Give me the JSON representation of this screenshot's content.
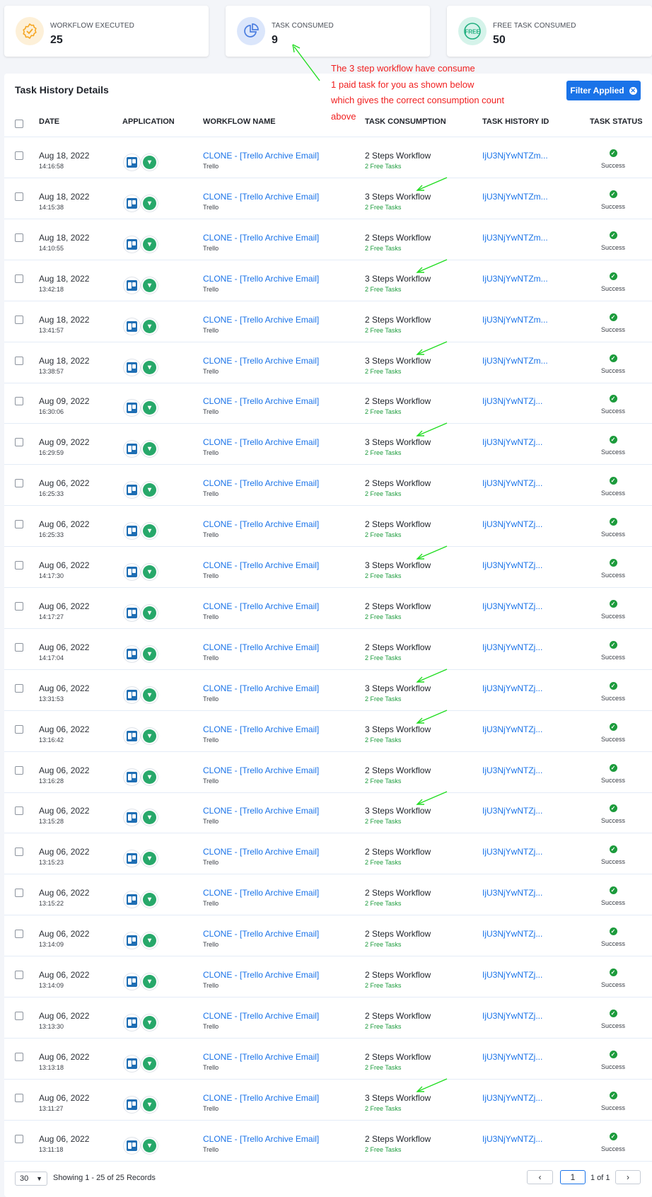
{
  "stats": [
    {
      "label": "WORKFLOW EXECUTED",
      "value": "25",
      "icon": "badge-check-icon",
      "color": "#f5a623"
    },
    {
      "label": "TASK CONSUMED",
      "value": "9",
      "icon": "pie-chart-icon",
      "color": "#4a7de0"
    },
    {
      "label": "FREE TASK CONSUMED",
      "value": "50",
      "icon": "free-icon",
      "color": "#1fae7e"
    }
  ],
  "annotation": {
    "line1": "The 3 step workflow have consume",
    "line2": "1 paid task for you as shown below",
    "line3": "which gives the correct consumption count",
    "line4": "above"
  },
  "panel": {
    "title": "Task History Details",
    "filter_label": "Filter Applied"
  },
  "columns": {
    "date": "DATE",
    "application": "APPLICATION",
    "workflow": "WORKFLOW NAME",
    "consumption": "TASK CONSUMPTION",
    "history_id": "TASK HISTORY ID",
    "status": "TASK STATUS"
  },
  "rows": [
    {
      "date": "Aug 18, 2022",
      "time": "14:16:58",
      "workflow": "CLONE - [Trello Archive Email]",
      "app": "Trello",
      "consumption": "2 Steps Workflow",
      "free": "2 Free Tasks",
      "history_id": "IjU3NjYwNTZm...",
      "status": "Success"
    },
    {
      "date": "Aug 18, 2022",
      "time": "14:15:38",
      "workflow": "CLONE - [Trello Archive Email]",
      "app": "Trello",
      "consumption": "3 Steps Workflow",
      "free": "2 Free Tasks",
      "history_id": "IjU3NjYwNTZm...",
      "status": "Success"
    },
    {
      "date": "Aug 18, 2022",
      "time": "14:10:55",
      "workflow": "CLONE - [Trello Archive Email]",
      "app": "Trello",
      "consumption": "2 Steps Workflow",
      "free": "2 Free Tasks",
      "history_id": "IjU3NjYwNTZm...",
      "status": "Success"
    },
    {
      "date": "Aug 18, 2022",
      "time": "13:42:18",
      "workflow": "CLONE - [Trello Archive Email]",
      "app": "Trello",
      "consumption": "3 Steps Workflow",
      "free": "2 Free Tasks",
      "history_id": "IjU3NjYwNTZm...",
      "status": "Success"
    },
    {
      "date": "Aug 18, 2022",
      "time": "13:41:57",
      "workflow": "CLONE - [Trello Archive Email]",
      "app": "Trello",
      "consumption": "2 Steps Workflow",
      "free": "2 Free Tasks",
      "history_id": "IjU3NjYwNTZm...",
      "status": "Success"
    },
    {
      "date": "Aug 18, 2022",
      "time": "13:38:57",
      "workflow": "CLONE - [Trello Archive Email]",
      "app": "Trello",
      "consumption": "3 Steps Workflow",
      "free": "2 Free Tasks",
      "history_id": "IjU3NjYwNTZm...",
      "status": "Success"
    },
    {
      "date": "Aug 09, 2022",
      "time": "16:30:06",
      "workflow": "CLONE - [Trello Archive Email]",
      "app": "Trello",
      "consumption": "2 Steps Workflow",
      "free": "2 Free Tasks",
      "history_id": "IjU3NjYwNTZj...",
      "status": "Success"
    },
    {
      "date": "Aug 09, 2022",
      "time": "16:29:59",
      "workflow": "CLONE - [Trello Archive Email]",
      "app": "Trello",
      "consumption": "3 Steps Workflow",
      "free": "2 Free Tasks",
      "history_id": "IjU3NjYwNTZj...",
      "status": "Success"
    },
    {
      "date": "Aug 06, 2022",
      "time": "16:25:33",
      "workflow": "CLONE - [Trello Archive Email]",
      "app": "Trello",
      "consumption": "2 Steps Workflow",
      "free": "2 Free Tasks",
      "history_id": "IjU3NjYwNTZj...",
      "status": "Success"
    },
    {
      "date": "Aug 06, 2022",
      "time": "16:25:33",
      "workflow": "CLONE - [Trello Archive Email]",
      "app": "Trello",
      "consumption": "2 Steps Workflow",
      "free": "2 Free Tasks",
      "history_id": "IjU3NjYwNTZj...",
      "status": "Success"
    },
    {
      "date": "Aug 06, 2022",
      "time": "14:17:30",
      "workflow": "CLONE - [Trello Archive Email]",
      "app": "Trello",
      "consumption": "3 Steps Workflow",
      "free": "2 Free Tasks",
      "history_id": "IjU3NjYwNTZj...",
      "status": "Success"
    },
    {
      "date": "Aug 06, 2022",
      "time": "14:17:27",
      "workflow": "CLONE - [Trello Archive Email]",
      "app": "Trello",
      "consumption": "2 Steps Workflow",
      "free": "2 Free Tasks",
      "history_id": "IjU3NjYwNTZj...",
      "status": "Success"
    },
    {
      "date": "Aug 06, 2022",
      "time": "14:17:04",
      "workflow": "CLONE - [Trello Archive Email]",
      "app": "Trello",
      "consumption": "2 Steps Workflow",
      "free": "2 Free Tasks",
      "history_id": "IjU3NjYwNTZj...",
      "status": "Success"
    },
    {
      "date": "Aug 06, 2022",
      "time": "13:31:53",
      "workflow": "CLONE - [Trello Archive Email]",
      "app": "Trello",
      "consumption": "3 Steps Workflow",
      "free": "2 Free Tasks",
      "history_id": "IjU3NjYwNTZj...",
      "status": "Success"
    },
    {
      "date": "Aug 06, 2022",
      "time": "13:16:42",
      "workflow": "CLONE - [Trello Archive Email]",
      "app": "Trello",
      "consumption": "3 Steps Workflow",
      "free": "2 Free Tasks",
      "history_id": "IjU3NjYwNTZj...",
      "status": "Success"
    },
    {
      "date": "Aug 06, 2022",
      "time": "13:16:28",
      "workflow": "CLONE - [Trello Archive Email]",
      "app": "Trello",
      "consumption": "2 Steps Workflow",
      "free": "2 Free Tasks",
      "history_id": "IjU3NjYwNTZj...",
      "status": "Success"
    },
    {
      "date": "Aug 06, 2022",
      "time": "13:15:28",
      "workflow": "CLONE - [Trello Archive Email]",
      "app": "Trello",
      "consumption": "3 Steps Workflow",
      "free": "2 Free Tasks",
      "history_id": "IjU3NjYwNTZj...",
      "status": "Success"
    },
    {
      "date": "Aug 06, 2022",
      "time": "13:15:23",
      "workflow": "CLONE - [Trello Archive Email]",
      "app": "Trello",
      "consumption": "2 Steps Workflow",
      "free": "2 Free Tasks",
      "history_id": "IjU3NjYwNTZj...",
      "status": "Success"
    },
    {
      "date": "Aug 06, 2022",
      "time": "13:15:22",
      "workflow": "CLONE - [Trello Archive Email]",
      "app": "Trello",
      "consumption": "2 Steps Workflow",
      "free": "2 Free Tasks",
      "history_id": "IjU3NjYwNTZj...",
      "status": "Success"
    },
    {
      "date": "Aug 06, 2022",
      "time": "13:14:09",
      "workflow": "CLONE - [Trello Archive Email]",
      "app": "Trello",
      "consumption": "2 Steps Workflow",
      "free": "2 Free Tasks",
      "history_id": "IjU3NjYwNTZj...",
      "status": "Success"
    },
    {
      "date": "Aug 06, 2022",
      "time": "13:14:09",
      "workflow": "CLONE - [Trello Archive Email]",
      "app": "Trello",
      "consumption": "2 Steps Workflow",
      "free": "2 Free Tasks",
      "history_id": "IjU3NjYwNTZj...",
      "status": "Success"
    },
    {
      "date": "Aug 06, 2022",
      "time": "13:13:30",
      "workflow": "CLONE - [Trello Archive Email]",
      "app": "Trello",
      "consumption": "2 Steps Workflow",
      "free": "2 Free Tasks",
      "history_id": "IjU3NjYwNTZj...",
      "status": "Success"
    },
    {
      "date": "Aug 06, 2022",
      "time": "13:13:18",
      "workflow": "CLONE - [Trello Archive Email]",
      "app": "Trello",
      "consumption": "2 Steps Workflow",
      "free": "2 Free Tasks",
      "history_id": "IjU3NjYwNTZj...",
      "status": "Success"
    },
    {
      "date": "Aug 06, 2022",
      "time": "13:11:27",
      "workflow": "CLONE - [Trello Archive Email]",
      "app": "Trello",
      "consumption": "3 Steps Workflow",
      "free": "2 Free Tasks",
      "history_id": "IjU3NjYwNTZj...",
      "status": "Success"
    },
    {
      "date": "Aug 06, 2022",
      "time": "13:11:18",
      "workflow": "CLONE - [Trello Archive Email]",
      "app": "Trello",
      "consumption": "2 Steps Workflow",
      "free": "2 Free Tasks",
      "history_id": "IjU3NjYwNTZj...",
      "status": "Success"
    }
  ],
  "footer": {
    "page_size": "30",
    "records_text": "Showing 1 - 25 of 25 Records",
    "prev": "‹",
    "page_input": "1",
    "page_of": "1 of 1",
    "next": "›"
  },
  "colors": {
    "accent": "#1a73e8",
    "success": "#1c9b3c",
    "annotation": "#f02020",
    "arrow": "#22dd22"
  }
}
